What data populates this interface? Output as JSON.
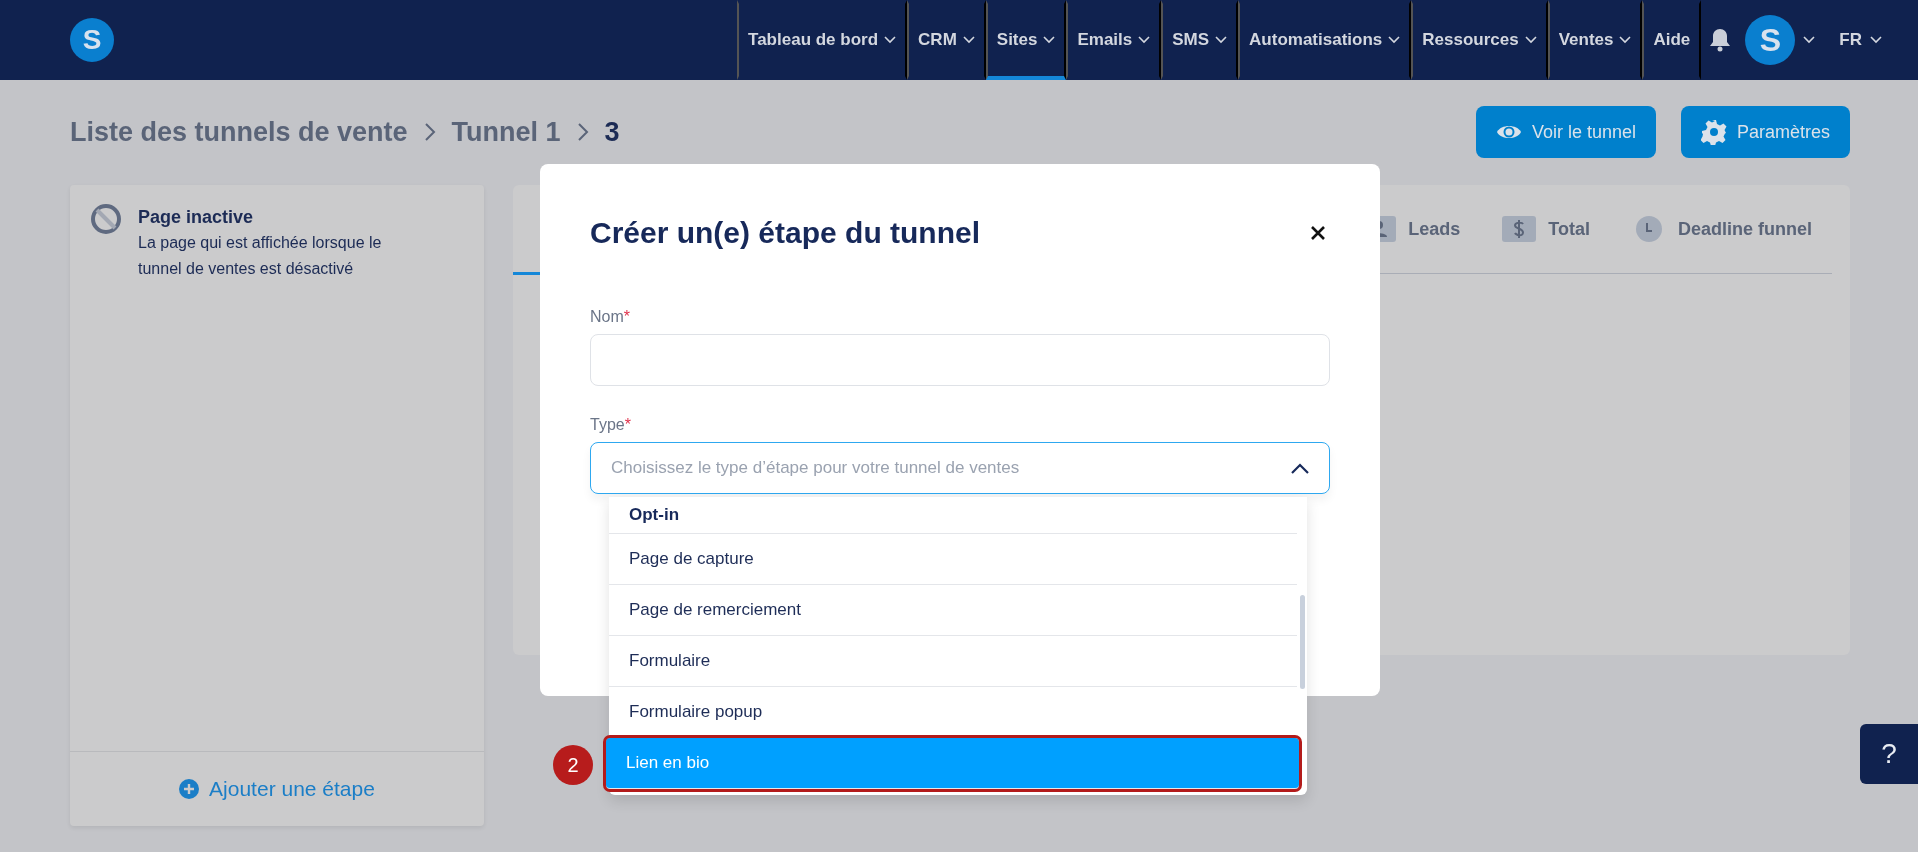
{
  "nav": {
    "logo": "S",
    "items": [
      {
        "label": "Tableau de bord",
        "dropdown": true,
        "selected": false
      },
      {
        "label": "CRM",
        "dropdown": true,
        "selected": false
      },
      {
        "label": "Sites",
        "dropdown": true,
        "selected": true
      },
      {
        "label": "Emails",
        "dropdown": true,
        "selected": false
      },
      {
        "label": "SMS",
        "dropdown": true,
        "selected": false
      },
      {
        "label": "Automatisations",
        "dropdown": true,
        "selected": false
      },
      {
        "label": "Ressources",
        "dropdown": true,
        "selected": false
      },
      {
        "label": "Ventes",
        "dropdown": true,
        "selected": false
      },
      {
        "label": "Aide",
        "dropdown": false,
        "selected": false
      }
    ],
    "avatar": "S",
    "language": "FR"
  },
  "breadcrumb": [
    {
      "label": "Liste des tunnels de vente",
      "current": false
    },
    {
      "label": "Tunnel 1",
      "current": false
    },
    {
      "label": "3",
      "current": true
    }
  ],
  "actions": [
    {
      "label": "Voir le tunnel",
      "kind": "eye"
    },
    {
      "label": "Paramètres",
      "kind": "gear"
    }
  ],
  "sidebar": {
    "pages": [
      {
        "title": "Page inactive",
        "description": "La page qui est affichée lorsque le tunnel de ventes est désactivé",
        "kind": "inactive"
      }
    ],
    "add_button": "Ajouter une étape"
  },
  "stats_tabs": [
    {
      "label": "Leads",
      "kind": "person"
    },
    {
      "label": "Total",
      "kind": "dollar"
    },
    {
      "label": "Deadline funnel",
      "kind": "clock"
    }
  ],
  "modal": {
    "title": "Créer un(e) étape du tunnel",
    "fields": [
      {
        "label": "Nom",
        "required_mark": "*",
        "kind": "text"
      },
      {
        "label": "Type",
        "required_mark": "*",
        "kind": "select",
        "placeholder": "Choisissez le type d’étape pour votre tunnel de ventes",
        "expanded": true
      }
    ]
  },
  "dropdown": {
    "groups": [
      {
        "label": "Opt-in",
        "options": [
          {
            "label": "Page de capture",
            "selected": false,
            "highlighted": false
          },
          {
            "label": "Page de remerciement",
            "selected": false,
            "highlighted": false
          },
          {
            "label": "Formulaire",
            "selected": false,
            "highlighted": false
          },
          {
            "label": "Formulaire popup",
            "selected": false,
            "highlighted": false
          },
          {
            "label": "Lien en bio",
            "selected": true,
            "highlighted": true
          }
        ]
      }
    ]
  },
  "annotation": {
    "label": "2"
  },
  "help_button": "?"
}
